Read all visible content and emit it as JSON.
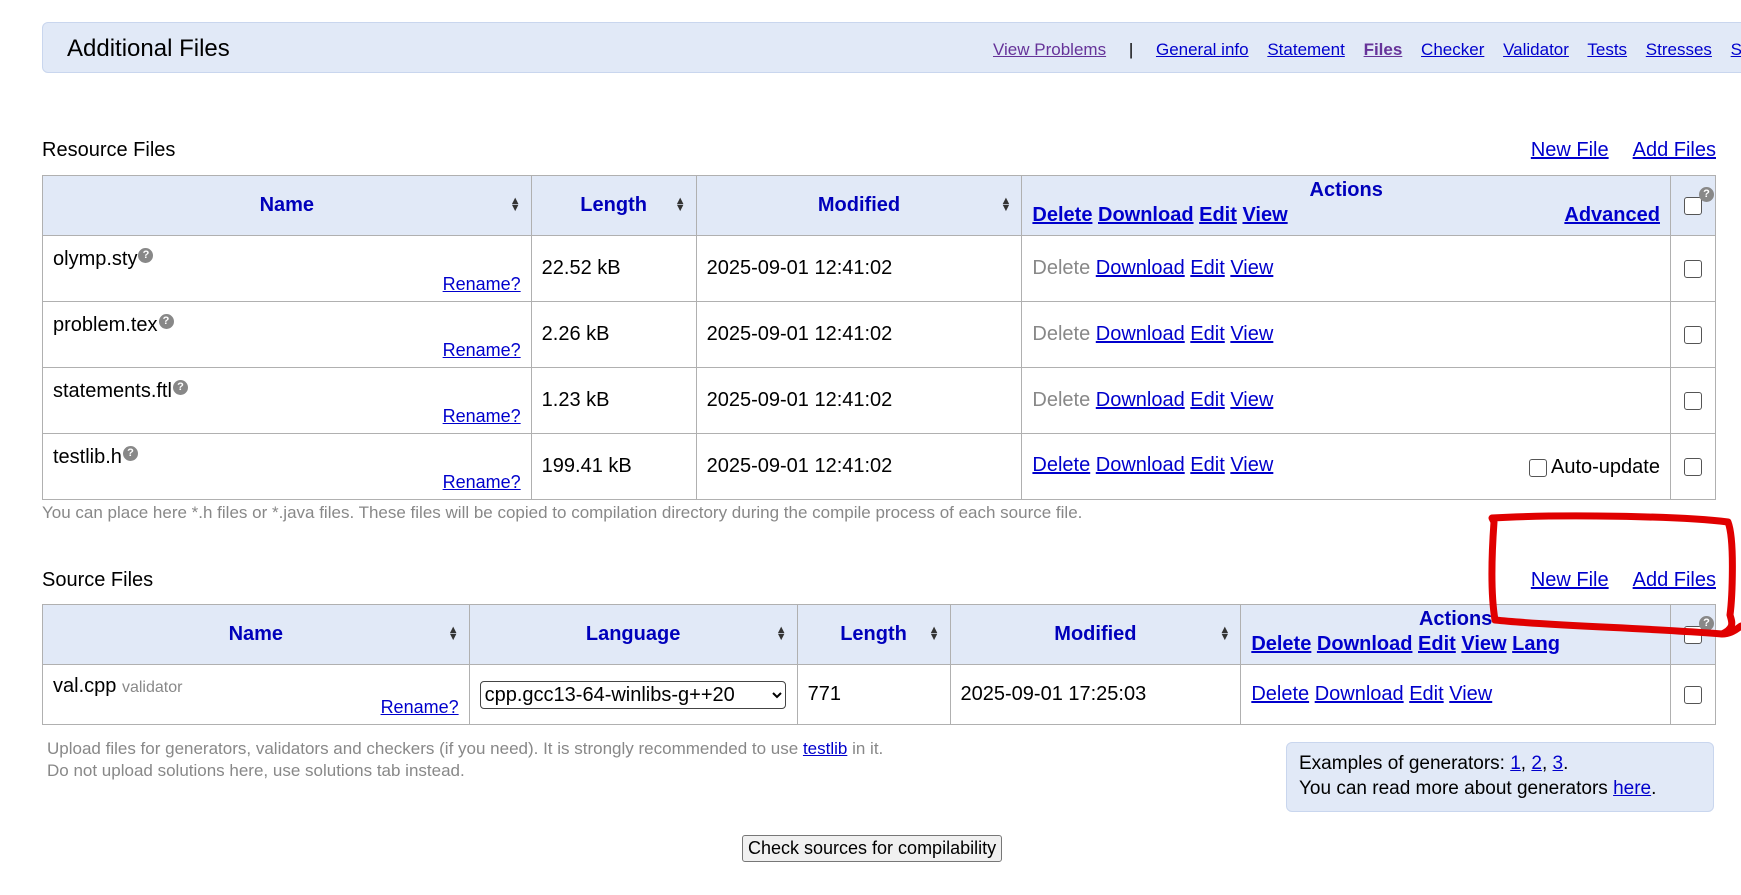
{
  "header": {
    "title": "Additional Files",
    "nav": [
      {
        "label": "View Problems",
        "style": "visited"
      },
      {
        "label": "General info",
        "style": "normal"
      },
      {
        "label": "Statement",
        "style": "normal"
      },
      {
        "label": "Files",
        "style": "active"
      },
      {
        "label": "Checker",
        "style": "normal"
      },
      {
        "label": "Validator",
        "style": "normal"
      },
      {
        "label": "Tests",
        "style": "normal"
      },
      {
        "label": "Stresses",
        "style": "normal"
      },
      {
        "label": "Sol",
        "style": "normal"
      }
    ],
    "separator": "|"
  },
  "resource": {
    "title": "Resource Files",
    "new_file": "New File",
    "add_files": "Add Files",
    "columns": {
      "name": "Name",
      "length": "Length",
      "modified": "Modified",
      "actions": "Actions"
    },
    "header_actions": [
      "Delete",
      "Download",
      "Edit",
      "View"
    ],
    "advanced": "Advanced",
    "rename": "Rename?",
    "rows": [
      {
        "name": "olymp.sty",
        "length": "22.52 kB",
        "modified": "2025-09-01 12:41:02",
        "delete_enabled": false
      },
      {
        "name": "problem.tex",
        "length": "2.26 kB",
        "modified": "2025-09-01 12:41:02",
        "delete_enabled": false
      },
      {
        "name": "statements.ftl",
        "length": "1.23 kB",
        "modified": "2025-09-01 12:41:02",
        "delete_enabled": false
      },
      {
        "name": "testlib.h",
        "length": "199.41 kB",
        "modified": "2025-09-01 12:41:02",
        "delete_enabled": true,
        "auto_update": "Auto-update"
      }
    ],
    "row_actions": {
      "delete": "Delete",
      "download": "Download",
      "edit": "Edit",
      "view": "View"
    },
    "note": "You can place here *.h files or *.java files. These files will be copied to compilation directory during the compile process of each source file."
  },
  "source": {
    "title": "Source Files",
    "new_file": "New File",
    "add_files": "Add Files",
    "columns": {
      "name": "Name",
      "language": "Language",
      "length": "Length",
      "modified": "Modified",
      "actions": "Actions"
    },
    "header_actions": [
      "Delete",
      "Download",
      "Edit",
      "View",
      "Lang"
    ],
    "rename": "Rename?",
    "rows": [
      {
        "name": "val.cpp",
        "tag": "validator",
        "language": "cpp.gcc13-64-winlibs-g++20",
        "length": "771",
        "modified": "2025-09-01 17:25:03"
      }
    ],
    "row_actions": {
      "delete": "Delete",
      "download": "Download",
      "edit": "Edit",
      "view": "View"
    },
    "note_line1_pre": "Upload files for generators, validators and checkers (if you need). It is strongly recommended to use ",
    "note_link": "testlib",
    "note_line1_post": " in it.",
    "note_line2": "Do not upload solutions here, use solutions tab instead."
  },
  "generators": {
    "examples_label": "Examples of generators: ",
    "examples": [
      "1",
      "2",
      "3"
    ],
    "read_more_pre": "You can read more about generators ",
    "read_more_link": "here",
    "period": "."
  },
  "check_button": "Check sources for compilability",
  "colors": {
    "link": "#0000cc",
    "header_bg": "#e1e9f7",
    "visited": "#663399",
    "annotation": "#e00000"
  }
}
